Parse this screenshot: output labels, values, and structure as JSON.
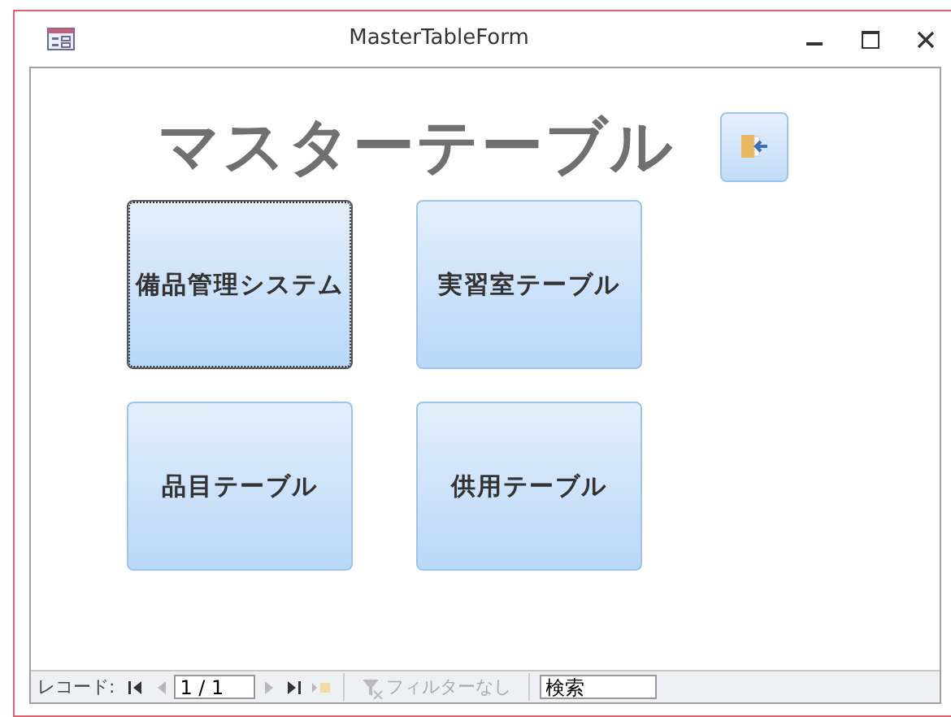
{
  "window": {
    "title": "MasterTableForm"
  },
  "heading": "マスターテーブル",
  "exit_button": {
    "disabled": false
  },
  "buttons": [
    {
      "label": "備品管理システム",
      "focused": true
    },
    {
      "label": "実習室テーブル",
      "focused": false
    },
    {
      "label": "品目テーブル",
      "focused": false
    },
    {
      "label": "供用テーブル",
      "focused": false
    }
  ],
  "navigation": {
    "label": "レコード:",
    "record": "1 / 1",
    "controls": [
      {
        "kind": "first",
        "disabled": false
      },
      {
        "kind": "prev",
        "disabled": true
      }
    ],
    "controls_after": [
      {
        "kind": "next",
        "disabled": true
      },
      {
        "kind": "last",
        "disabled": false
      },
      {
        "kind": "new",
        "disabled": true
      }
    ],
    "filter": {
      "label": "フィルターなし",
      "disabled": true
    },
    "search": {
      "placeholder": "検索"
    }
  }
}
